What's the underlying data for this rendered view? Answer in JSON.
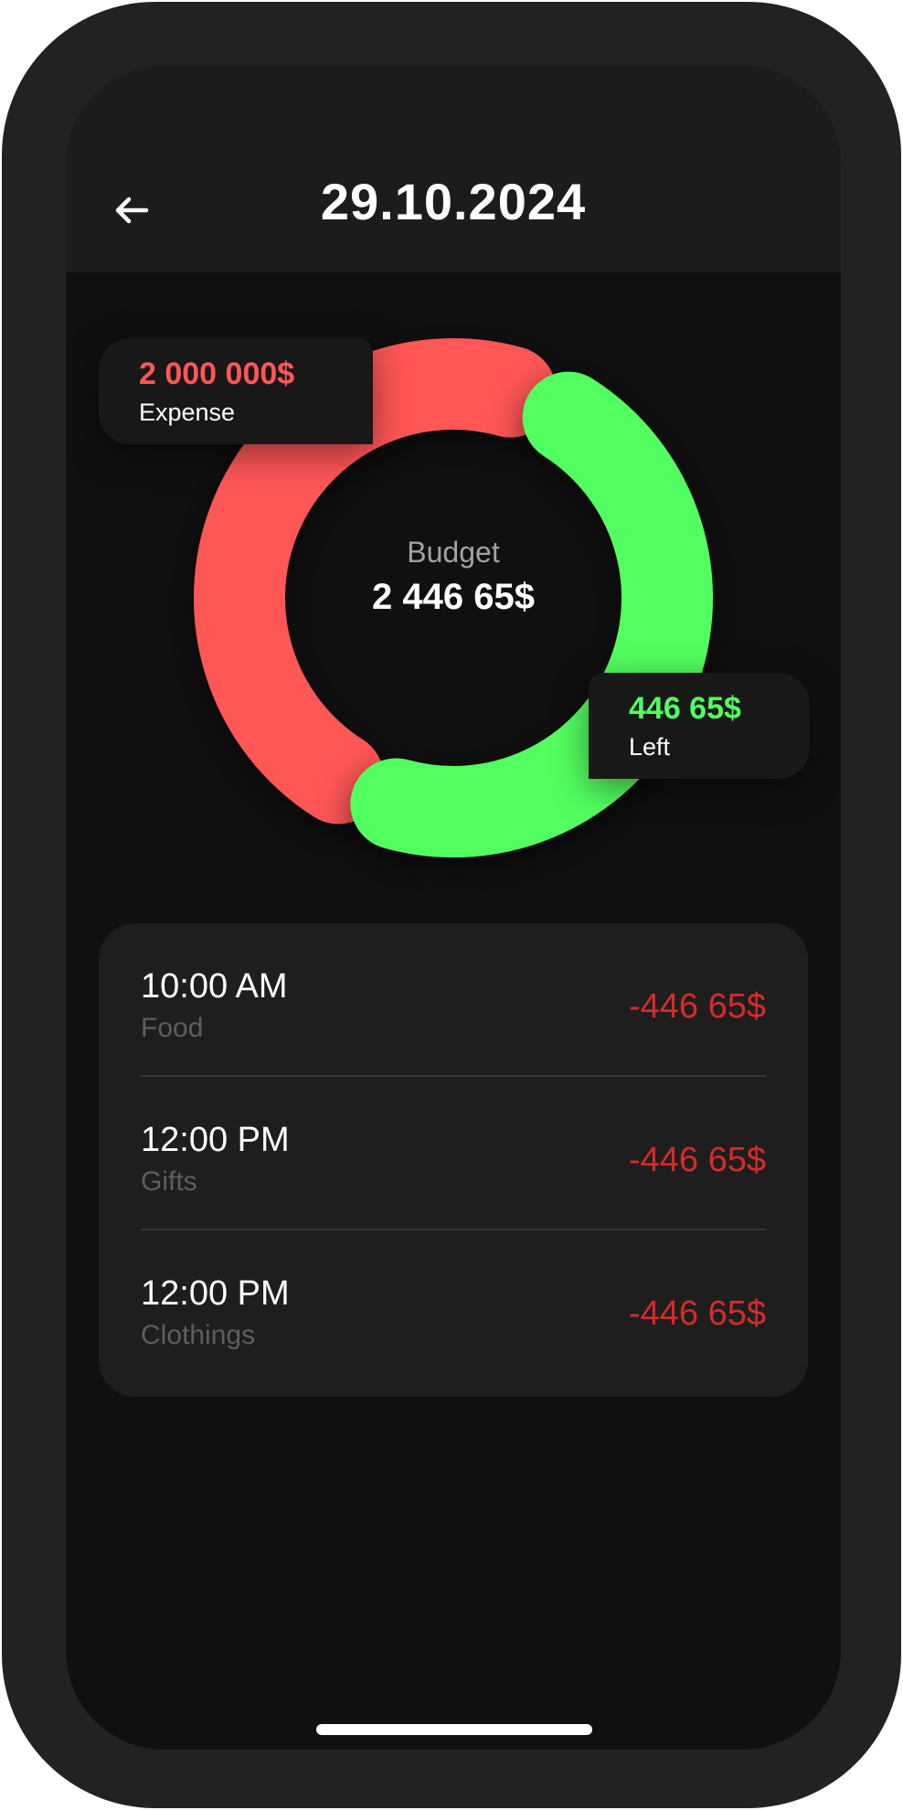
{
  "header": {
    "title": "29.10.2024",
    "back_icon": "arrow-left-icon"
  },
  "budget": {
    "label": "Budget",
    "total": "2 446 65$"
  },
  "expense": {
    "value": "2 000 000$",
    "label": "Expense",
    "color": "#ff5656"
  },
  "left": {
    "value": "446 65$",
    "label": "Left",
    "color": "#52ff61"
  },
  "chart_data": {
    "type": "pie",
    "categories": [
      "Expense",
      "Left"
    ],
    "values": [
      0.5,
      0.5
    ]
  },
  "transactions": [
    {
      "time": "10:00 AM",
      "category": "Food",
      "amount": "-446 65$"
    },
    {
      "time": "12:00 PM",
      "category": "Gifts",
      "amount": "-446 65$"
    },
    {
      "time": "12:00 PM",
      "category": "Clothings",
      "amount": "-446 65$"
    }
  ],
  "colors": {
    "negative_amount": "#d72a2a",
    "background": "#101010",
    "card": "#1e1e1e"
  }
}
